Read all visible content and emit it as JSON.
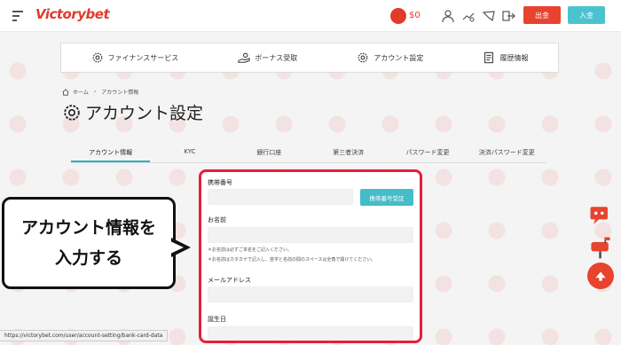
{
  "header": {
    "logo_text": "Victorybet",
    "balance": "$0",
    "withdraw_label": "出金",
    "deposit_label": "入金"
  },
  "menu": [
    {
      "label": "ファイナンスサービス",
      "icon": "gear-icon"
    },
    {
      "label": "ボーナス受取",
      "icon": "hand-coin-icon"
    },
    {
      "label": "アカウント設定",
      "icon": "gear-icon"
    },
    {
      "label": "履歴情報",
      "icon": "document-icon"
    }
  ],
  "breadcrumb": {
    "home": "ホーム",
    "current": "アカウント情報"
  },
  "page_title": "アカウント設定",
  "tabs": [
    {
      "label": "アカウント情報",
      "active": true
    },
    {
      "label": "KYC",
      "active": false
    },
    {
      "label": "銀行口座",
      "active": false
    },
    {
      "label": "第三者決済",
      "active": false
    },
    {
      "label": "パスワード変更",
      "active": false
    },
    {
      "label": "決済パスワード変更",
      "active": false
    }
  ],
  "form": {
    "phone_label": "携帯番号",
    "phone_value": "",
    "verify_button": "携帯番号受証",
    "name_label": "お名前",
    "name_value": "",
    "name_note_1": "＊お名前は必ずご本名をご記入ください。",
    "name_note_2": "＊お名前はカタカナで記入し、苗字と名前の間のスペースは全角で開けてください。",
    "email_label": "メールアドレス",
    "email_value": "",
    "birthday_label": "誕生日"
  },
  "callout": {
    "line1": "アカウント情報を",
    "line2": "入力する"
  },
  "status_url": "https://victorybet.com/user/account-setting/bank-card-data",
  "colors": {
    "accent_red": "#e8432f",
    "accent_teal": "#45bcc7",
    "highlight_frame": "#e5203b"
  }
}
